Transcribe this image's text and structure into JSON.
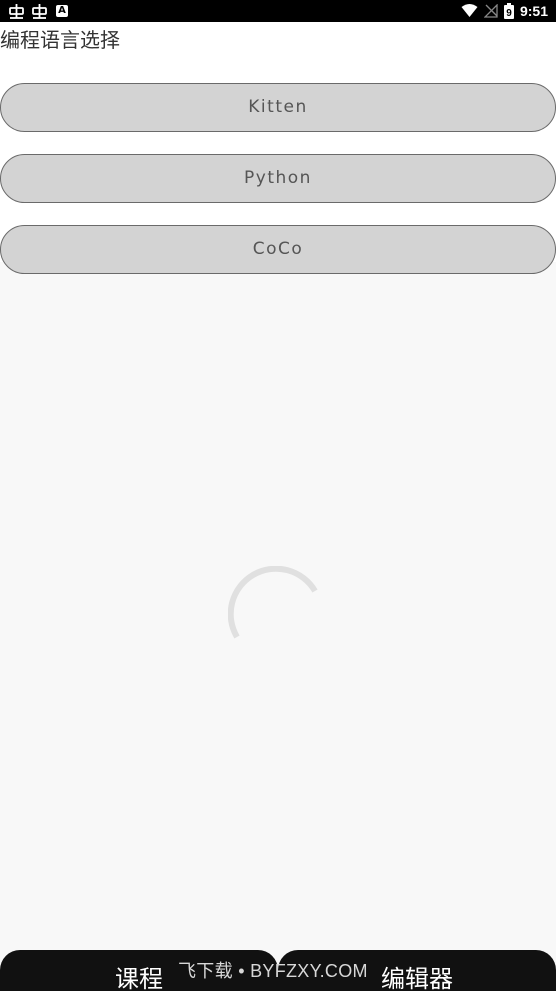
{
  "status_bar": {
    "time": "9:51",
    "battery_level": "9",
    "icons": [
      "bug-icon",
      "bug-icon",
      "a-icon",
      "wifi-icon",
      "no-signal-icon",
      "battery-icon"
    ]
  },
  "page": {
    "title": "编程语言选择"
  },
  "languages": [
    {
      "label": "Kitten"
    },
    {
      "label": "Python"
    },
    {
      "label": "CoCo"
    }
  ],
  "bottom_nav": {
    "tabs": [
      {
        "label": "课程"
      },
      {
        "label": "编辑器"
      }
    ]
  },
  "watermark": {
    "text": "飞下载 • BYFZXY.COM"
  },
  "colors": {
    "background": "#f8f8f8",
    "button_fill": "#d3d3d3",
    "button_border": "#6a6a6a",
    "nav_background": "#111111",
    "spinner": "#e0e0e0"
  }
}
